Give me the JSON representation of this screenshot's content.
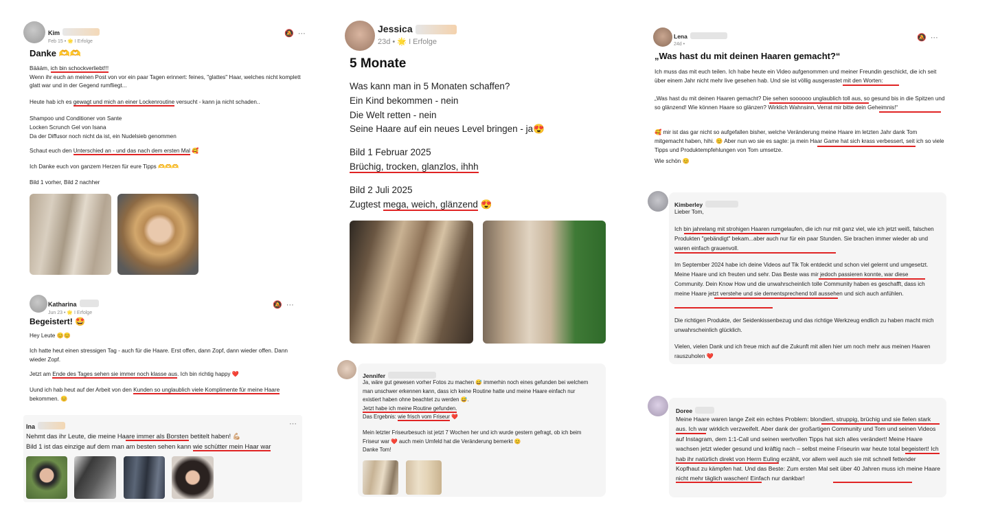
{
  "kim": {
    "name": "Kim",
    "meta": "Feb 15 • 🌟 I Erfolge",
    "title": "Danke 🫶🫶",
    "p1_pre": "Bäääm, ",
    "p1_ul": "ich bin schockverliebt!!!",
    "p1_rest": "Wenn ihr euch an meinen Post von vor ein paar Tagen erinnert: feines, \"glattes\" Haar, welches nicht komplett glatt war und in der Gegend rumfliegt...",
    "p2_pre": "Heute hab ich es ",
    "p2_ul": "gewagt und mich an einer Lockenroutine",
    "p2_post": " versucht - kann ja nicht schaden..",
    "p3": "Shampoo und Conditioner von Sante\nLocken Scrunch Gel von Isana\nDa der Diffusor noch nicht da ist, ein Nudelsieb genommen",
    "p4_pre": "Schaut euch den ",
    "p4_ul": "Unterschied an - und das nach dem ersten Mal",
    "p4_post": " 🥰",
    "p5": "Ich Danke euch von ganzem Herzen für eure Tipps 🫶🫶🫶",
    "p6": "Bild 1 vorher, Bild 2 nachher"
  },
  "katharina": {
    "name": "Katharina",
    "meta": "Jun 23 • 🌟 I Erfolge",
    "title": "Begeistert! 🤩",
    "p1": "Hey Leute 😊😊",
    "p2": "Ich hatte heut einen stressigen Tag - auch für die Haare. Erst offen, dann Zopf, dann wieder offen. Dann wieder Zopf.",
    "p3_pre": "Jetzt am ",
    "p3_ul": "Ende des Tages sehen sie immer noch klasse aus",
    "p3_post": ". Ich bin richtig happy ❤️",
    "p4_pre": "Uund ich hab heut auf der Arbeit von den ",
    "p4_ul": "Kunden so unglaublich viele Komplimente für meine Haare",
    "p4_post": " bekommen. 😊"
  },
  "ina": {
    "name": "Ina",
    "line1_pre": "Nehmt das ihr Leute, die meine Ha",
    "line1_ul": "are immer als Borsten",
    "line1_post": " betitelt haben! 💪🏼",
    "line2_pre": "Bild 1 ist das einzige auf dem man am besten sehen kann ",
    "line2_ul": "wie schütter mein Haar war"
  },
  "jessica": {
    "name": "Jessica",
    "meta": "23d • 🌟 I Erfolge",
    "title": "5 Monate",
    "lines": "Was kann man in 5 Monaten schaffen?\nEin Kind bekommen - nein\nDie Welt retten - nein\nSeine Haare auf ein neues Level bringen - ja😍",
    "bild1": "Bild 1 Februar 2025",
    "bild1_ul": "Brüchig, trocken, glanzlos, ihhh",
    "bild2": "Bild 2 Juli 2025",
    "bild2_pre": "Zugtest ",
    "bild2_ul": "mega, weich, glänzend",
    "bild2_post": " 😍"
  },
  "jennifer": {
    "name": "Jennifer",
    "p1": "Ja, wäre gut gewesen vorher Fotos zu machen 😅 immerhin noch eines gefunden bei welchem man unschwer erkennen kann, dass ich keine Routine hatte und meine Haare einfach nur existiert haben ohne beachtet zu werden 😅.",
    "p2_ul": "Jetzt habe ich meine Routine gefunden.",
    "p3_pre": "Das Ergebnis: ",
    "p3_ul": "wie frisch vom Friseur",
    "p3_post": " ❤️",
    "p4": "Mein letzter Friseurbesuch ist jetzt 7 Wochen her und ich wurde gestern gefragt, ob ich beim Friseur war ❤️ auch mein Umfeld hat die Veränderung bemerkt 😊",
    "p5": "Danke Tom!"
  },
  "lena": {
    "name": "Lena",
    "meta": "24d •",
    "title": "„Was hast du mit deinen Haaren gemacht?“",
    "p1": "Ich muss das mit euch teilen. Ich habe heute ein Video aufgenommen und meiner Freundin geschickt, die ich seit über einem Jahr nicht mehr live gesehen hab. Und sie ist völlig ausgerastet mit den Worten:",
    "p2": "„Was hast du mit deinen Haaren gemacht? Die sehen soooooo unglaublich toll aus, so gesund bis in die Spitzen und so glänzend! Wie können Haare so glänzen? Wirklich Wahnsinn, Verrat mir bitte dein Geheimnis!“",
    "p3": "🥰 mir ist das gar nicht so aufgefallen bisher, welche Veränderung meine Haare im letzten Jahr dank Tom mitgemacht haben, hihi. 😊 Aber nun wo sie es sagte: ja mein Haar Game hat sich krass verbessert, seit ich so viele Tipps und Produktempfehlungen von Tom umsetze.",
    "p4": "Wie schön 😊"
  },
  "kimberley": {
    "name": "Kimberley",
    "p0": "Lieber Tom,",
    "p1": "Ich bin jahrelang mit strohigen Haaren rumgelaufen, die ich nur mit ganz viel, wie ich jetzt weiß, falschen Produkten \"gebändigt\" bekam...aber auch nur für ein paar Stunden. Sie brachen immer wieder ab und waren einfach grauenvoll.",
    "p2": "Im September 2024 habe ich deine Videos auf Tik Tok entdeckt und schon viel gelernt und umgesetzt. Meine Haare und ich freuten und sehr. Das Beste was mir jedoch passieren konnte, war diese Community. Dein Know How und die unwahrscheinlich tolle Community haben es geschafft, dass ich meine Haare jetzt verstehe und sie dementsprechend toll aussehen und sich auch anfühlen.",
    "p3": "Die richtigen Produkte, der Seidenkissenbezug und das richtige Werkzeug endlich zu haben macht mich unwahrscheinlich glücklich.",
    "p4": "Vielen, vielen Dank und ich freue mich auf die Zukunft mit allen hier um noch mehr aus meinen Haaren rauszuholen ❤️"
  },
  "doree": {
    "name": "Doree",
    "p1": "Meine Haare waren lange Zeit ein echtes Problem: blondiert, struppig, brüchig und sie fielen stark aus. Ich war wirklich verzweifelt. Aber dank der großartigen Community und Tom und seinen Videos auf Instagram, dem 1:1-Call und seinen wertvollen Tipps hat sich alles verändert! Meine Haare wachsen jetzt wieder gesund und kräftig nach – selbst meine Friseurin war heute total begeistert! Ich hab ihr natürlich direkt von Herrn Euling erzählt, vor allem weil auch sie mit schnell fettender Kopfhaut zu kämpfen hat. Und das Beste: Zum ersten Mal seit über 40 Jahren muss ich meine Haare nicht mehr täglich waschen! Einfach nur dankbar!"
  },
  "icons": {
    "bell": "🔕",
    "more": "⋯"
  }
}
